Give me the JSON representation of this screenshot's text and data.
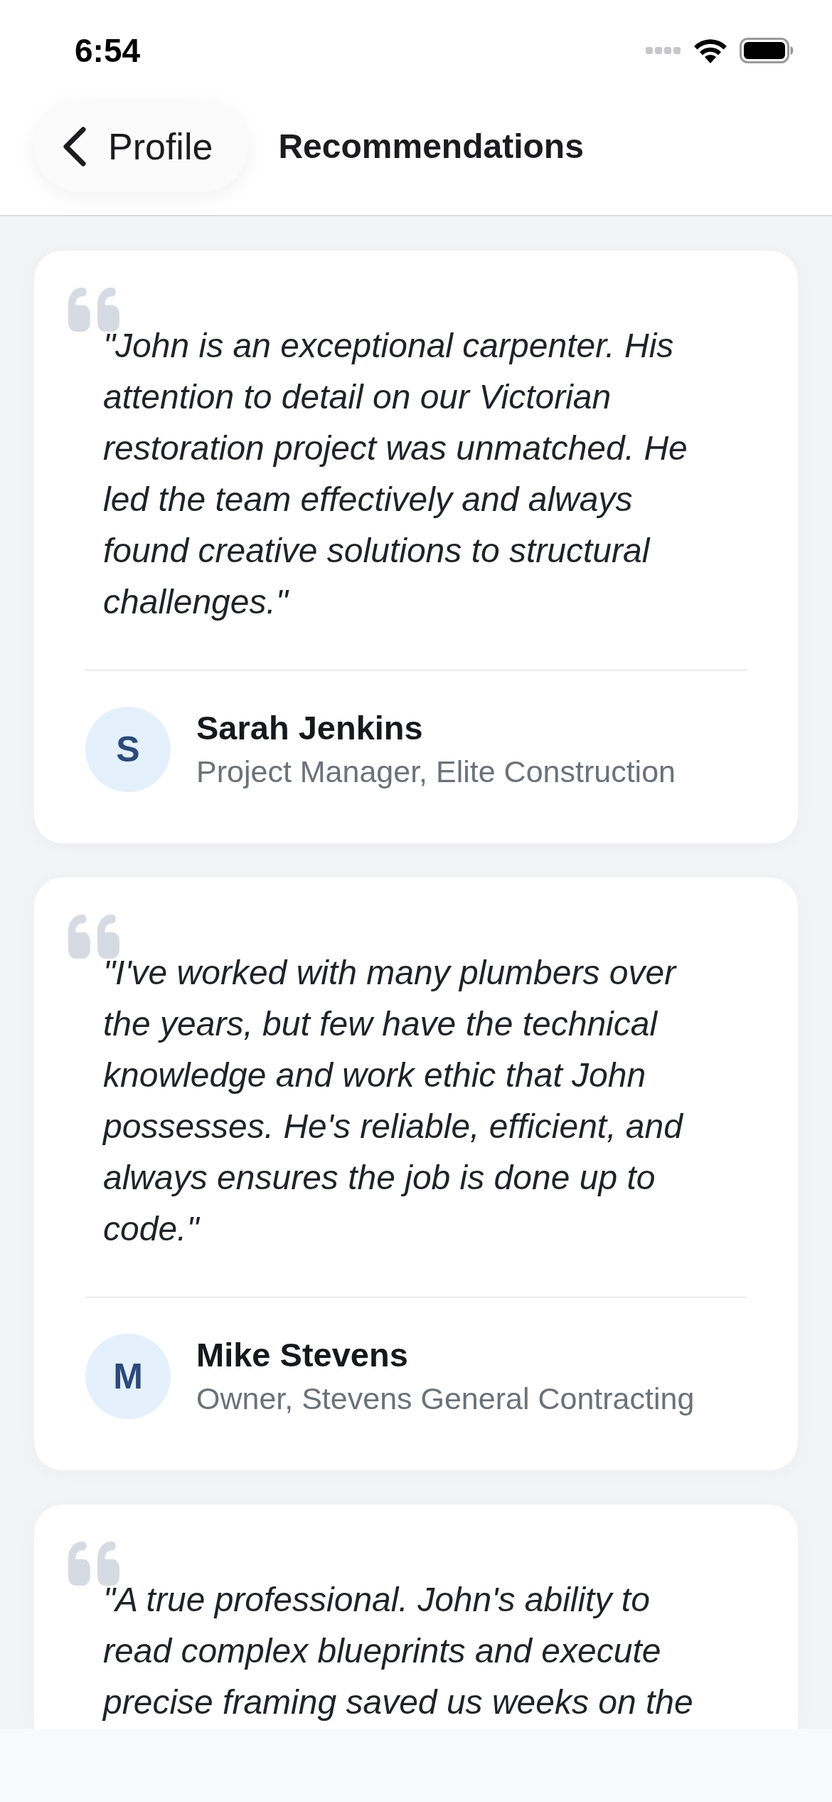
{
  "status_bar": {
    "time": "6:54"
  },
  "nav": {
    "back_label": "Profile",
    "title": "Recommendations"
  },
  "recommendations": [
    {
      "quote": "\"John is an exceptional carpenter. His attention to detail on our Victorian restoration project was unmatched. He led the team effectively and always found creative solutions to structural challenges.\"",
      "author": {
        "initial": "S",
        "name": "Sarah Jenkins",
        "role": "Project Manager, Elite Construction"
      }
    },
    {
      "quote": "\"I've worked with many plumbers over the years, but few have the technical knowledge and work ethic that John possesses. He's reliable, efficient, and always ensures the job is done up to code.\"",
      "author": {
        "initial": "M",
        "name": "Mike Stevens",
        "role": "Owner, Stevens General Contracting"
      }
    },
    {
      "quote": "\"A true professional. John's ability to read complex blueprints and execute precise framing saved us weeks on the"
    }
  ]
}
